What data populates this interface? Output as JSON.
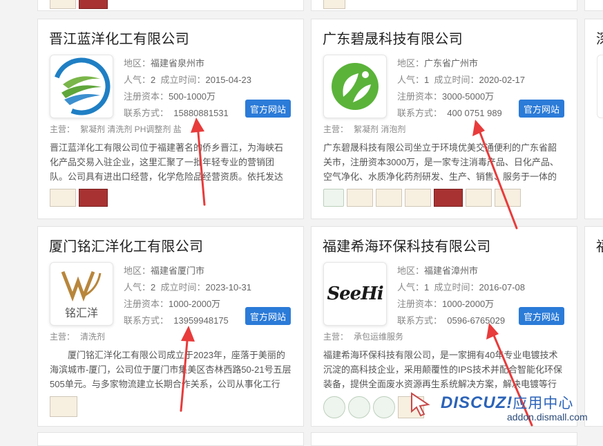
{
  "colors": {
    "accent": "#2b7bd8",
    "arrow": "#e83b3b",
    "watermark": "#2b63b8"
  },
  "labels": {
    "region": "地区：",
    "popularity": "人气：",
    "founded": "成立时间：",
    "capital": "注册资本：",
    "contact": "联系方式：",
    "main_biz": "主营："
  },
  "companies": [
    {
      "name": "晋江蓝洋化工有限公司",
      "logo": "wave-logo",
      "region": "福建省泉州市",
      "popularity": "2",
      "founded": "2015-04-23",
      "capital": "500-1000万",
      "contact": "15880881531",
      "site_button": "官方网站",
      "main_biz": "絮凝剂 清洗剂 PH调整剂 盐",
      "desc": "晋江蓝洋化工有限公司位于福建著名的侨乡晋江，为海峡石化产品交易入驻企业，这里汇聚了一批年轻专业的营销团队。公司具有进出口经营，化学危险品经营资质。依托发达"
    },
    {
      "name": "广东碧晟科技有限公司",
      "logo": "leaf-logo",
      "region": "广东省广州市",
      "popularity": "1",
      "founded": "2020-02-17",
      "capital": "3000-5000万",
      "contact": "400 0751 989",
      "site_button": "官方网站",
      "main_biz": "絮凝剂 消泡剂",
      "desc": "广东碧晟科技有限公司坐立于环境优美交通便利的广东省韶关市，注册资本3000万，是一家专注消毒产品、日化产品、空气净化、水质净化药剂研发、生产、销售、服务于一体的"
    },
    {
      "name": "厦门铭汇洋化工有限公司",
      "logo": "mhy-logo",
      "logo_text": "铭汇洋",
      "region": "福建省厦门市",
      "popularity": "2",
      "founded": "2023-10-31",
      "capital": "1000-2000万",
      "contact": "13959948175",
      "site_button": "官方网站",
      "main_biz": "清洗剂",
      "desc": "厦门铭汇洋化工有限公司成立于2023年，座落于美丽的海滨城市-厦门，公司位于厦门市集美区杏林西路50-21号五层505单元。与多家物流建立长期合作关系，公司从事化工行"
    },
    {
      "name": "福建希海环保科技有限公司",
      "logo": "seehi-logo",
      "logo_text": "SeeHi",
      "region": "福建省漳州市",
      "popularity": "1",
      "founded": "2016-07-08",
      "capital": "1000-2000万",
      "contact": "0596-6765029",
      "site_button": "官方网站",
      "main_biz": "承包运维服务",
      "desc": "福建希海环保科技有限公司，是一家拥有40年专业电镀技术沉淀的高科技企业，采用颠覆性的IPS技术并配合智能化环保装备，提供全面废水资源再生系统解决方案，解决电镀等行"
    }
  ],
  "partial_right": {
    "title_chars": [
      "深",
      "福"
    ]
  },
  "watermark": {
    "brand": "DISCUZ!",
    "cn": "应用中心",
    "url": "addon.dismall.com"
  }
}
